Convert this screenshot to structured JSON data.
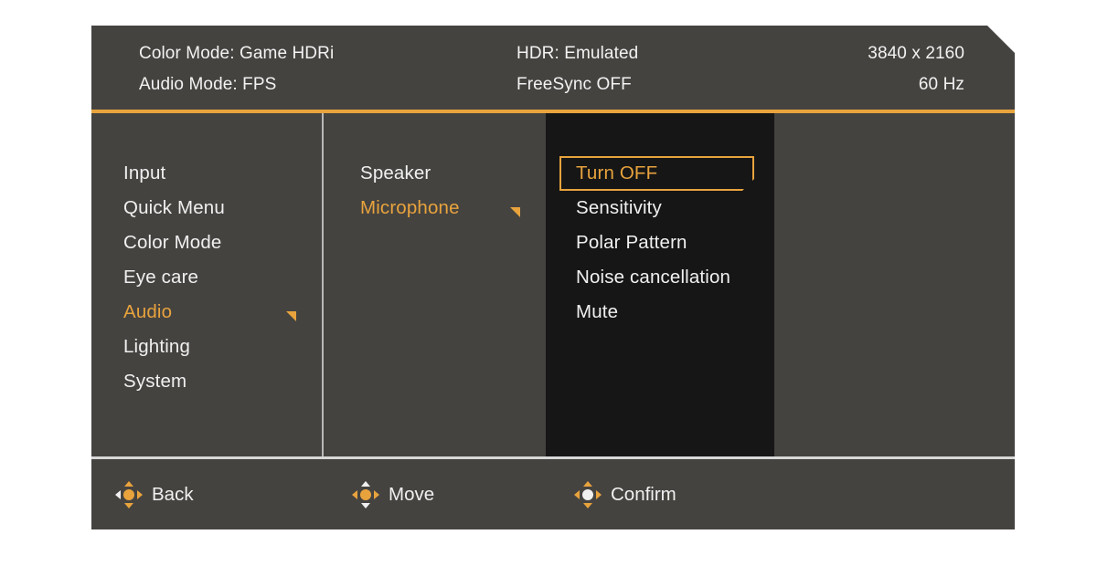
{
  "header": {
    "rows": [
      {
        "left": "Color Mode: Game HDRi",
        "middle": "HDR: Emulated",
        "right": "3840 x 2160"
      },
      {
        "left": "Audio Mode: FPS",
        "middle": "FreeSync OFF",
        "right": "60 Hz"
      }
    ]
  },
  "columns": {
    "level1": [
      {
        "label": "Input",
        "active": false,
        "has_submenu": false
      },
      {
        "label": "Quick Menu",
        "active": false,
        "has_submenu": false
      },
      {
        "label": "Color Mode",
        "active": false,
        "has_submenu": false
      },
      {
        "label": "Eye care",
        "active": false,
        "has_submenu": false
      },
      {
        "label": "Audio",
        "active": true,
        "has_submenu": true
      },
      {
        "label": "Lighting",
        "active": false,
        "has_submenu": false
      },
      {
        "label": "System",
        "active": false,
        "has_submenu": false
      }
    ],
    "level2": [
      {
        "label": "Speaker",
        "active": false,
        "has_submenu": false
      },
      {
        "label": "Microphone",
        "active": true,
        "has_submenu": true
      }
    ],
    "level3": [
      {
        "label": "Turn OFF",
        "active": true,
        "selected": true
      },
      {
        "label": "Sensitivity",
        "active": false,
        "selected": false
      },
      {
        "label": "Polar Pattern",
        "active": false,
        "selected": false
      },
      {
        "label": "Noise cancellation",
        "active": false,
        "selected": false
      },
      {
        "label": "Mute",
        "active": false,
        "selected": false
      }
    ]
  },
  "footer": {
    "actions": [
      {
        "label": "Back",
        "icon": "joystick-left-icon"
      },
      {
        "label": "Move",
        "icon": "joystick-updown-icon"
      },
      {
        "label": "Confirm",
        "icon": "joystick-center-icon"
      }
    ]
  },
  "colors": {
    "accent": "#E8A33D",
    "panel": "#454340",
    "panel_dark": "#161616",
    "text": "#F0F0F0"
  }
}
